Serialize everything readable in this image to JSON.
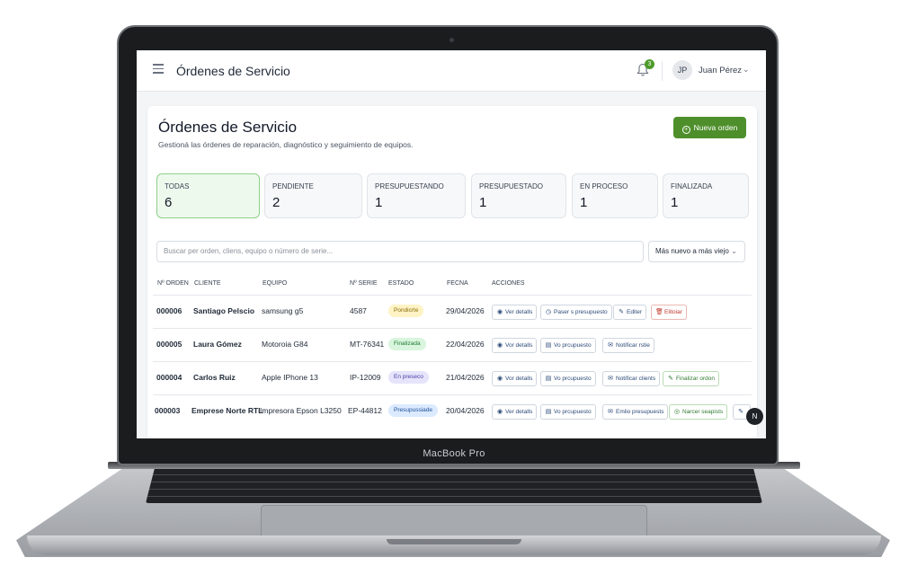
{
  "device": {
    "label": "MacBook Pro"
  },
  "topbar": {
    "title": "Órdenes de Servicio",
    "notifications": "3",
    "user_initials": "JP",
    "user_name": "Juan Pérez"
  },
  "page": {
    "title": "Órdenes de Servicio",
    "subtitle": "Gestioná las órdenes de reparación, diagnóstico y seguimiento de equipos.",
    "new_button": "Nueva orden"
  },
  "tabs": [
    {
      "label": "TODAS",
      "count": "6"
    },
    {
      "label": "PENDIENTE",
      "count": "2"
    },
    {
      "label": "PRESUPUESTANDO",
      "count": "1"
    },
    {
      "label": "PRESUPUESTADO",
      "count": "1"
    },
    {
      "label": "EN PROCESO",
      "count": "1"
    },
    {
      "label": "FINALIZADA",
      "count": "1"
    }
  ],
  "search": {
    "placeholder": "Buscar per orden, cliens, equipo o número de serie..."
  },
  "sort": {
    "value": "Más nuevo a más viejo"
  },
  "table": {
    "headers": [
      "Nº ORDEN",
      "CLIENTE",
      "EQUIPO",
      "Nº SERIE",
      "ESTADO",
      "FECNA",
      "ACCIONES"
    ],
    "rows": [
      {
        "orden": "000006",
        "cliente": "Santiago Pelscio",
        "equipo": "samsung g5",
        "serie": "4587",
        "estado": "Pondicrte",
        "fecha": "29/04/2026",
        "actions": [
          "Ver detalls",
          "Paser s presupuesto",
          "Editer",
          "Elitoiar"
        ]
      },
      {
        "orden": "000005",
        "cliente": "Laura Gómez",
        "equipo": "Motoroia G84",
        "serie": "MT-76341",
        "estado": "Finalizada",
        "fecha": "22/04/2026",
        "actions": [
          "Vor detalls",
          "Vo prcupuesto",
          "Notificar rstie"
        ]
      },
      {
        "orden": "000004",
        "cliente": "Carlos Ruiz",
        "equipo": "Apple IPhone 13",
        "serie": "IP-12009",
        "estado": "En preseco",
        "fecha": "21/04/2026",
        "actions": [
          "Vor detalls",
          "Vo prcupuesto",
          "Notificar clients",
          "Finalizar ordon"
        ]
      },
      {
        "orden": "000003",
        "cliente": "Emprese Norte RTL",
        "equipo": "Impresora Epson L3250",
        "serie": "EP-44812",
        "estado": "Presupussiade",
        "fecha": "20/04/2026",
        "actions": [
          "Ver detalls",
          "Vo prcupuesto",
          "Emlio presupuests",
          "Narcer seapists"
        ]
      }
    ]
  },
  "fab": {
    "label": "N"
  },
  "colors": {
    "accent": "#4e8f2c",
    "status_pending": "#fdf3c4",
    "status_finished": "#d9f5dd",
    "status_in_process": "#e6e4fb",
    "status_quoted": "#dbeafe"
  }
}
